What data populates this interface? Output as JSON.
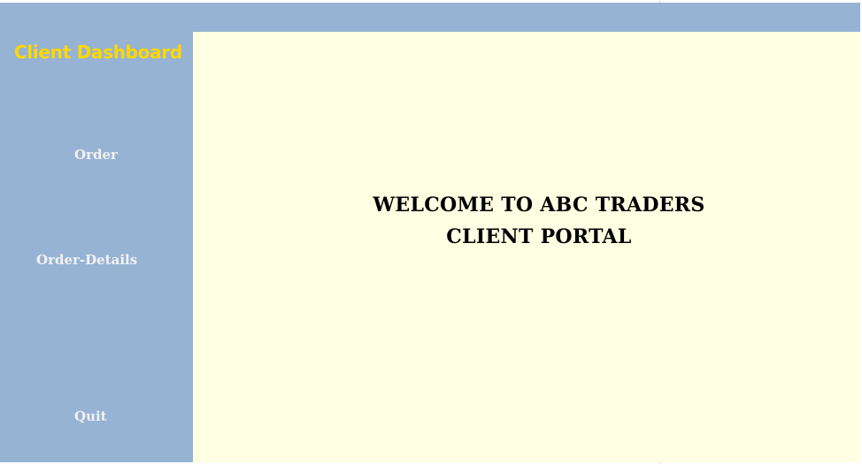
{
  "sidebar": {
    "title": "Client Dashboard",
    "items": [
      {
        "label": "Order"
      },
      {
        "label": "Order-Details"
      },
      {
        "label": "Quit"
      }
    ]
  },
  "main": {
    "welcome_line1": "WELCOME TO ABC TRADERS",
    "welcome_line2": "CLIENT PORTAL"
  },
  "colors": {
    "frame": "#97b3d3",
    "title": "#ffd700",
    "nav_text": "#f2f2f2",
    "content_bg": "#ffffe3",
    "welcome_text": "#000000"
  }
}
